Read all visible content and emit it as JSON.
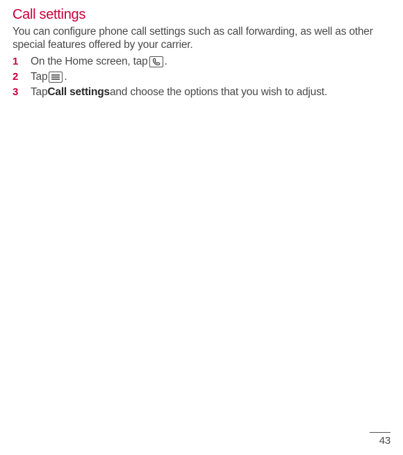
{
  "title": "Call settings",
  "intro": "You can configure phone call settings such as call forwarding, as well as other special features offered by your carrier.",
  "steps": {
    "s1": {
      "num": "1",
      "pre": "On the Home screen, tap ",
      "post": "."
    },
    "s2": {
      "num": "2",
      "pre": "Tap ",
      "post": "."
    },
    "s3": {
      "num": "3",
      "pre": "Tap ",
      "bold": "Call settings",
      "post": " and choose the options that you wish to adjust."
    }
  },
  "page_number": "43"
}
